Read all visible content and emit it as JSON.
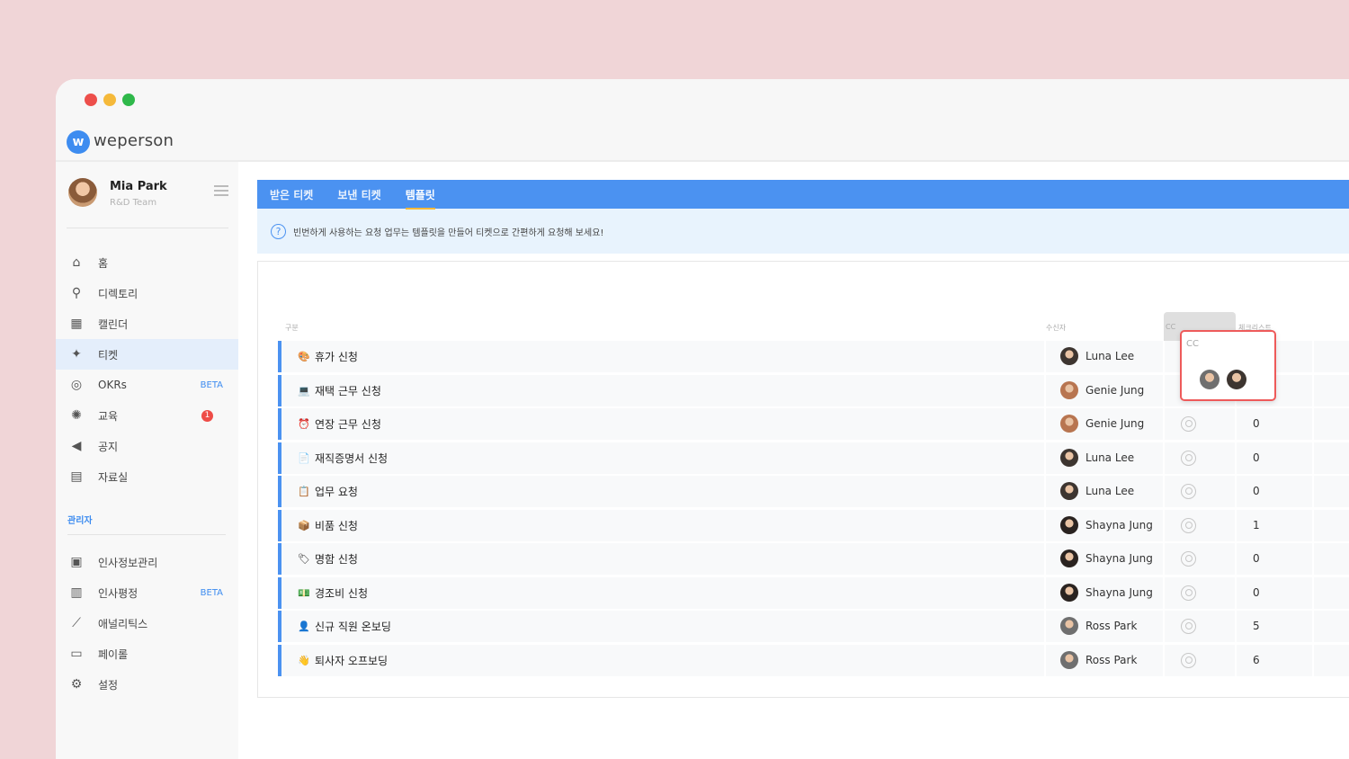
{
  "app": {
    "logo_text": "weperson",
    "logo_mark": "w"
  },
  "profile": {
    "name": "Mia Park",
    "team": "R&D Team"
  },
  "nav": [
    {
      "label": "홈",
      "icon": "home-icon",
      "glyph": "⌂"
    },
    {
      "label": "디렉토리",
      "icon": "org-chart-icon",
      "glyph": "⚲"
    },
    {
      "label": "캘린더",
      "icon": "calendar-icon",
      "glyph": "▦"
    },
    {
      "label": "티켓",
      "icon": "ticket-icon",
      "glyph": "✦",
      "active": true
    },
    {
      "label": "OKRs",
      "icon": "target-icon",
      "glyph": "◎",
      "tag": "BETA"
    },
    {
      "label": "교육",
      "icon": "lightbulb-icon",
      "glyph": "✺",
      "badge": "1"
    },
    {
      "label": "공지",
      "icon": "megaphone-icon",
      "glyph": "◀"
    },
    {
      "label": "자료실",
      "icon": "archive-icon",
      "glyph": "▤"
    }
  ],
  "admin_section": "관리자",
  "admin_nav": [
    {
      "label": "인사정보관리",
      "icon": "id-card-icon",
      "glyph": "▣"
    },
    {
      "label": "인사평정",
      "icon": "hr-eval-icon",
      "glyph": "▥",
      "tag": "BETA"
    },
    {
      "label": "애널리틱스",
      "icon": "analytics-icon",
      "glyph": "⟋"
    },
    {
      "label": "페이롤",
      "icon": "payroll-icon",
      "glyph": "▭"
    },
    {
      "label": "설정",
      "icon": "gear-icon",
      "glyph": "⚙"
    }
  ],
  "tabs": [
    {
      "label": "받은 티켓"
    },
    {
      "label": "보낸 티켓"
    },
    {
      "label": "템플릿",
      "active": true
    }
  ],
  "notice": "빈번하게 사용하는 요청 업무는 템플릿을 만들어 티켓으로 간편하게 요청해 보세요!",
  "table": {
    "headers": {
      "category": "구분",
      "recipient": "수신자",
      "cc": "CC",
      "checklist": "체크리스트"
    },
    "rows": [
      {
        "emoji": "🎨",
        "title": "휴가 신청",
        "recipient": "Luna Lee",
        "avatar": "#3d3530",
        "count": ""
      },
      {
        "emoji": "💻",
        "title": "재택 근무 신청",
        "recipient": "Genie Jung",
        "avatar": "#b87550",
        "count": ""
      },
      {
        "emoji": "⏰",
        "title": "연장 근무 신청",
        "recipient": "Genie Jung",
        "avatar": "#b87550",
        "count": "0"
      },
      {
        "emoji": "📄",
        "title": "재직증명서 신청",
        "recipient": "Luna Lee",
        "avatar": "#3d3530",
        "count": "0"
      },
      {
        "emoji": "📋",
        "title": "업무 요청",
        "recipient": "Luna Lee",
        "avatar": "#3d3530",
        "count": "0"
      },
      {
        "emoji": "📦",
        "title": "비품 신청",
        "recipient": "Shayna Jung",
        "avatar": "#2a2320",
        "count": "1"
      },
      {
        "emoji": "🏷",
        "title": "명함 신청",
        "recipient": "Shayna Jung",
        "avatar": "#2a2320",
        "count": "0"
      },
      {
        "emoji": "💵",
        "title": "경조비 신청",
        "recipient": "Shayna Jung",
        "avatar": "#2a2320",
        "count": "0"
      },
      {
        "emoji": "👤",
        "title": "신규 직원 온보딩",
        "recipient": "Ross Park",
        "avatar": "#6f6f6f",
        "count": "5"
      },
      {
        "emoji": "👋",
        "title": "퇴사자 오프보딩",
        "recipient": "Ross Park",
        "avatar": "#6f6f6f",
        "count": "6"
      }
    ]
  },
  "cc_popup": {
    "label": "CC",
    "avatars": [
      "#6f6f6f",
      "#3d3530"
    ]
  },
  "colors": {
    "accent": "#4b92f1",
    "alert": "#ee4c47",
    "popup_border": "#ee5a5a"
  }
}
